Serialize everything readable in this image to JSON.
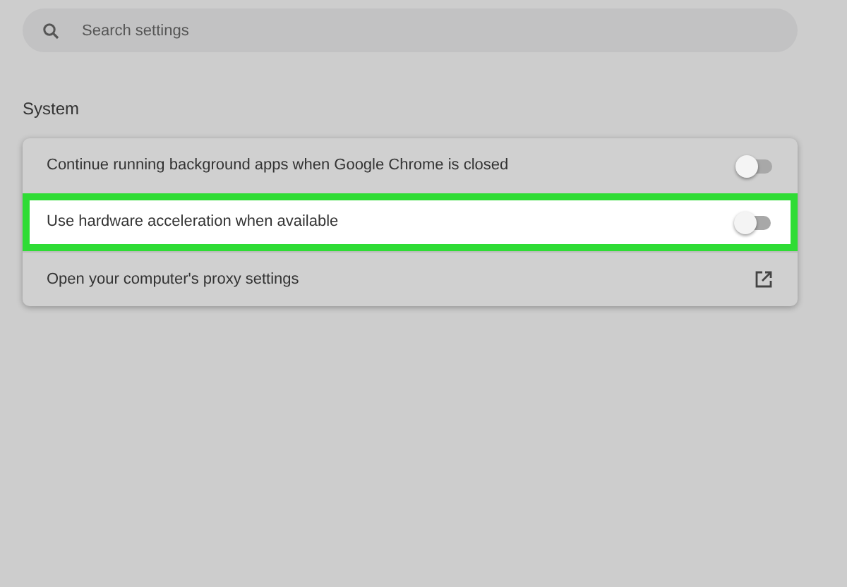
{
  "search": {
    "placeholder": "Search settings"
  },
  "section": {
    "title": "System"
  },
  "settings": [
    {
      "kind": "toggle",
      "label": "Continue running background apps when Google Chrome is closed",
      "on": false,
      "highlighted": false
    },
    {
      "kind": "toggle",
      "label": "Use hardware acceleration when available",
      "on": false,
      "highlighted": true
    },
    {
      "kind": "link",
      "label": "Open your computer's proxy settings",
      "highlighted": false
    }
  ]
}
